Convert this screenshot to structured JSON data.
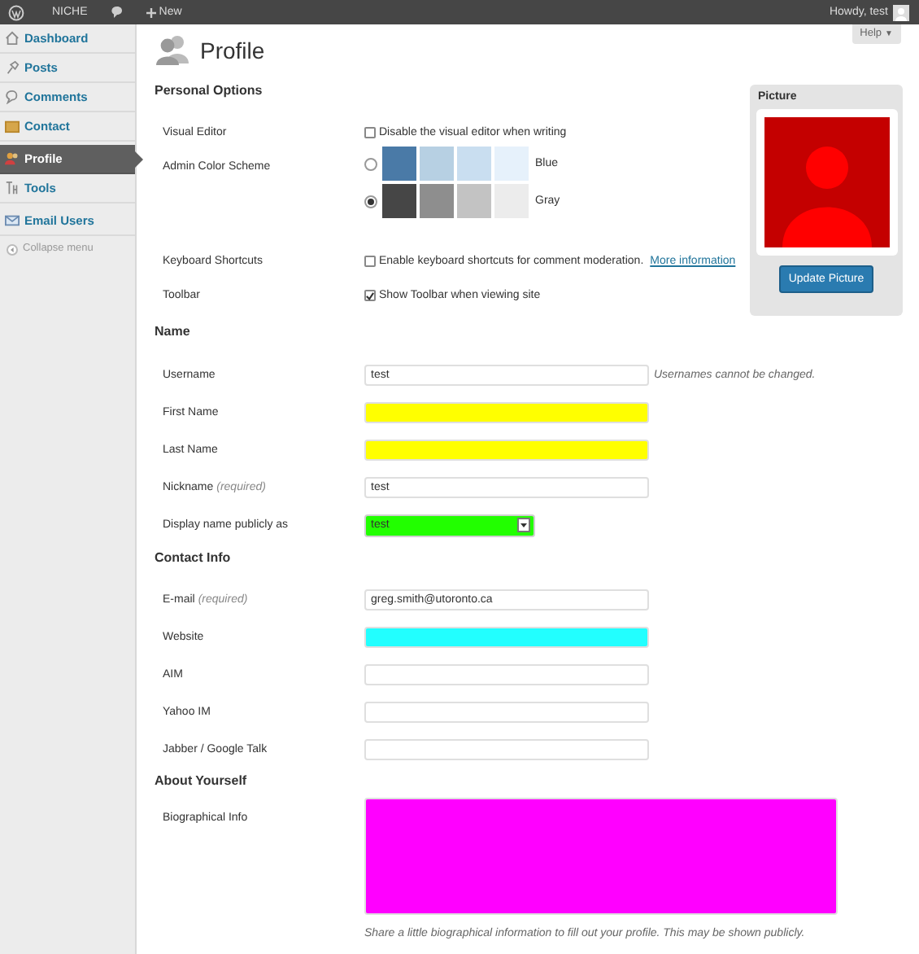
{
  "admin_bar": {
    "site": "NICHE",
    "new": "New",
    "greeting": "Howdy, test"
  },
  "help": "Help",
  "help_caret": "▼",
  "sidebar": {
    "items": [
      {
        "label": "Dashboard",
        "selected": false
      },
      {
        "label": "Posts",
        "selected": false
      },
      {
        "label": "Comments",
        "selected": false
      },
      {
        "label": "Contact",
        "selected": false
      },
      {
        "label": "Profile",
        "selected": true
      },
      {
        "label": "Tools",
        "selected": false
      },
      {
        "label": "Email Users",
        "selected": false
      }
    ],
    "collapse": "Collapse menu"
  },
  "page_title": "Profile",
  "picture_panel": {
    "title": "Picture",
    "button": "Update Picture"
  },
  "sections": [
    {
      "heading": "Personal Options",
      "rows": [
        {
          "kind": "checkbox",
          "label": "Visual Editor",
          "text": "Disable the visual editor when writing",
          "checked": false
        },
        {
          "kind": "schemes",
          "label": "Admin Color Scheme",
          "options": [
            {
              "name": "Blue",
              "selected": false
            },
            {
              "name": "Gray",
              "selected": true
            }
          ]
        },
        {
          "kind": "checkbox",
          "label": "Keyboard Shortcuts",
          "text": "Enable keyboard shortcuts for comment moderation.",
          "link": "More information",
          "checked": false
        },
        {
          "kind": "checkbox",
          "label": "Toolbar",
          "text": "Show Toolbar when viewing site",
          "checked": true
        }
      ]
    },
    {
      "heading": "Name",
      "rows": [
        {
          "kind": "text",
          "label": "Username",
          "value": "test",
          "note": "Usernames cannot be changed."
        },
        {
          "kind": "text",
          "label": "First Name",
          "color": "#ffff00"
        },
        {
          "kind": "text",
          "label": "Last Name",
          "color": "#ffff00"
        },
        {
          "kind": "text",
          "label": "Nickname",
          "required": "(required)",
          "value": "test"
        },
        {
          "kind": "select",
          "label": "Display name publicly as",
          "value": "test",
          "color": "#22ff00"
        }
      ]
    },
    {
      "heading": "Contact Info",
      "rows": [
        {
          "kind": "text",
          "label": "E-mail",
          "required": "(required)",
          "value": "greg.smith@utoronto.ca"
        },
        {
          "kind": "text",
          "label": "Website",
          "color": "#22ffff"
        },
        {
          "kind": "text",
          "label": "AIM"
        },
        {
          "kind": "text",
          "label": "Yahoo IM"
        },
        {
          "kind": "text",
          "label": "Jabber / Google Talk"
        }
      ]
    },
    {
      "heading": "About Yourself",
      "rows": [
        {
          "kind": "textarea",
          "label": "Biographical Info",
          "color": "#ff00ff",
          "note": "Share a little biographical information to fill out your profile. This may be shown publicly."
        }
      ]
    }
  ]
}
